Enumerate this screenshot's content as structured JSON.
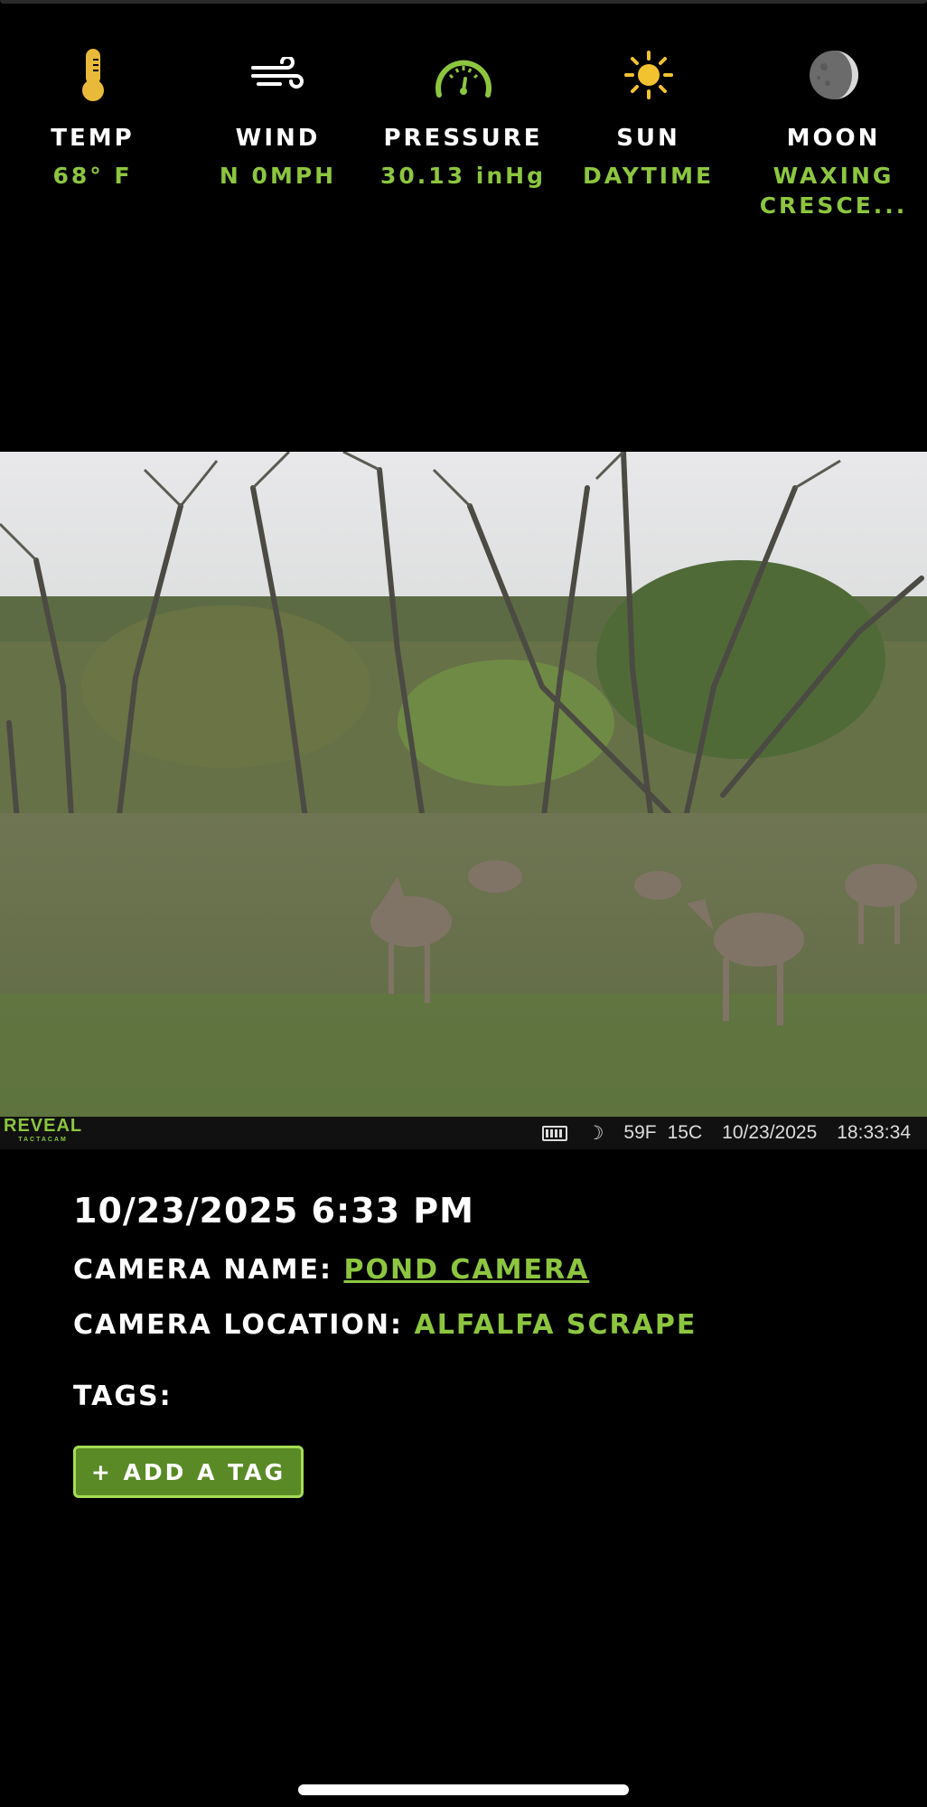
{
  "conditions": {
    "temp": {
      "label": "TEMP",
      "value": "68° F",
      "icon": "thermometer-icon"
    },
    "wind": {
      "label": "WIND",
      "value": "N 0MPH",
      "icon": "wind-icon"
    },
    "pressure": {
      "label": "PRESSURE",
      "value": "30.13 inHg",
      "icon": "gauge-icon"
    },
    "sun": {
      "label": "SUN",
      "value": "DAYTIME",
      "icon": "sun-icon"
    },
    "moon": {
      "label": "MOON",
      "value": "WAXING CRESCE...",
      "icon": "moon-icon"
    }
  },
  "photo": {
    "brand": "REVEAL",
    "brand_sub": "TACTACAM",
    "stamp_temp_f": "59F",
    "stamp_temp_c": "15C",
    "stamp_date": "10/23/2025",
    "stamp_time": "18:33:34"
  },
  "details": {
    "datetime": "10/23/2025 6:33 PM",
    "camera_name_label": "CAMERA NAME:",
    "camera_name": "POND CAMERA",
    "camera_location_label": "CAMERA LOCATION:",
    "camera_location": "ALFALFA SCRAPE",
    "tags_label": "TAGS:"
  },
  "actions": {
    "add_tag_label": "+ ADD A TAG"
  },
  "colors": {
    "accent": "#8cc63f",
    "icon_yellow": "#f2c230",
    "background": "#000000"
  }
}
